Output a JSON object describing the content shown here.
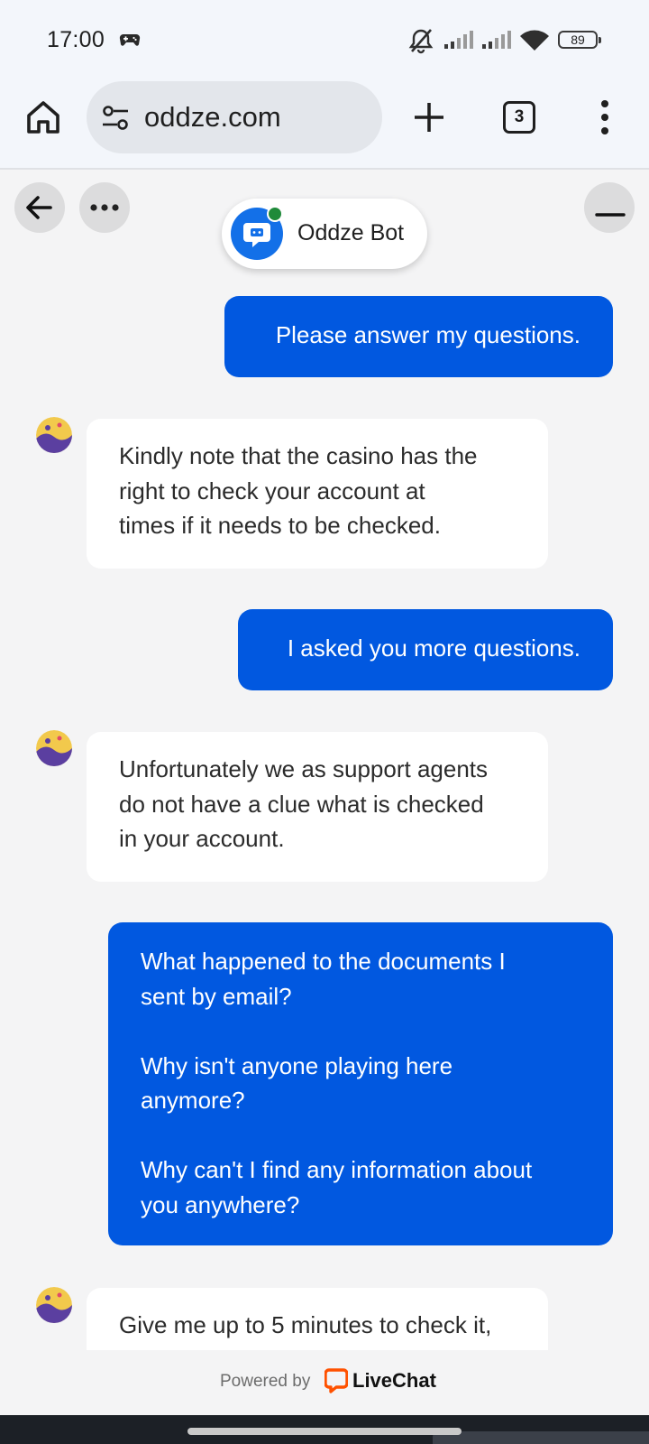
{
  "status_bar": {
    "time": "17:00",
    "battery": "89",
    "icons": [
      "gamepad-icon",
      "bell-off-icon",
      "signal-icon",
      "signal-icon",
      "wifi-icon",
      "battery-icon"
    ]
  },
  "browser": {
    "url": "oddze.com",
    "tab_count": "3",
    "icons": [
      "home-icon",
      "site-settings-icon",
      "new-tab-icon",
      "tab-switcher-icon",
      "more-vert-icon"
    ]
  },
  "chat": {
    "bot_name": "Oddze Bot",
    "header_icons": [
      "back-arrow-icon",
      "more-dots-icon",
      "minimize-icon"
    ],
    "messages": [
      {
        "from": "visitor",
        "text": "Please answer my questions."
      },
      {
        "from": "agent",
        "text": "Kindly note that the casino has the\nright to check your account at\ntimes if it needs to be checked."
      },
      {
        "from": "visitor",
        "text": "I asked you more questions."
      },
      {
        "from": "agent",
        "text": "Unfortunately we as support agents\ndo not have a clue what is checked\nin your account."
      },
      {
        "from": "visitor",
        "text": "What happened to the documents I\nsent by email?\n\nWhy isn't anyone playing here\nanymore?\n\nWhy can't I find any information about\nyou anywhere?"
      },
      {
        "from": "agent",
        "text": "Give me up to 5 minutes to check it,"
      }
    ]
  },
  "footer": {
    "powered_by": "Powered by",
    "brand": "LiveChat"
  },
  "colors": {
    "visitor_bubble": "#0158e0",
    "agent_bubble": "#ffffff",
    "background": "#f4f4f5",
    "online": "#1f8a3a",
    "livechat_orange": "#ff5100"
  }
}
